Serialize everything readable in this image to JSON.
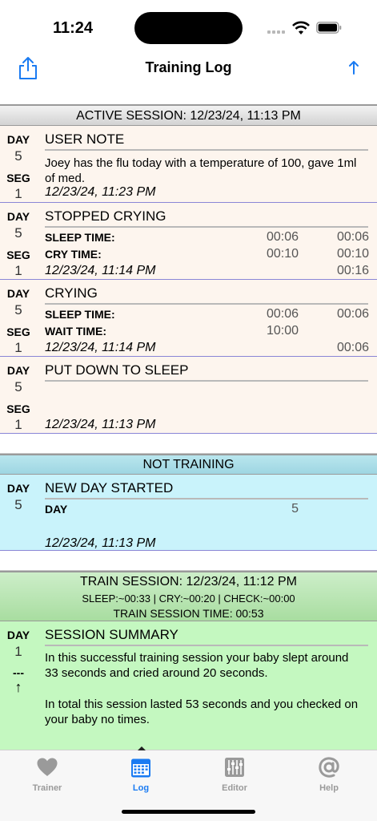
{
  "status": {
    "time": "11:24"
  },
  "nav": {
    "title": "Training Log"
  },
  "sessions": {
    "active": "ACTIVE SESSION: 12/23/24, 11:13 PM",
    "not_training": "NOT TRAINING",
    "train": {
      "title": "TRAIN SESSION: 12/23/24, 11:12 PM",
      "stats": "SLEEP:~00:33 | CRY:~00:20 | CHECK:~00:00",
      "time": "TRAIN SESSION TIME: 00:53"
    }
  },
  "labels": {
    "day": "DAY",
    "seg": "SEG",
    "dashes": "---",
    "up": "↑"
  },
  "rows": [
    {
      "day": "5",
      "seg": "1",
      "title": "USER NOTE",
      "note": "Joey has the flu today with a temperature of 100, gave 1ml of med.",
      "stamp": "12/23/24, 11:23 PM"
    },
    {
      "day": "5",
      "seg": "1",
      "title": "STOPPED CRYING",
      "f1": "SLEEP TIME:",
      "f1a": "00:06",
      "f1b": "00:06",
      "f2": "CRY TIME:",
      "f2a": "00:10",
      "f2b": "00:10",
      "total": "00:16",
      "stamp": "12/23/24, 11:14 PM"
    },
    {
      "day": "5",
      "seg": "1",
      "title": "CRYING",
      "f1": "SLEEP TIME:",
      "f1a": "00:06",
      "f1b": "00:06",
      "f2": "WAIT TIME:",
      "f2a": "10:00",
      "total": "00:06",
      "stamp": "12/23/24, 11:14 PM"
    },
    {
      "day": "5",
      "seg": "1",
      "title": "PUT DOWN TO SLEEP",
      "stamp": "12/23/24, 11:13 PM"
    },
    {
      "day": "5",
      "title": "NEW DAY STARTED",
      "f1": "DAY",
      "f1a": "5",
      "stamp": "12/23/24, 11:13 PM"
    },
    {
      "day": "1",
      "title": "SESSION SUMMARY",
      "p1": "In this successful training session your baby slept around 33 seconds and cried around 20 seconds.",
      "p2": "In total this session lasted 53 seconds and you checked on your baby no times."
    }
  ],
  "tabs": [
    {
      "label": "Trainer",
      "icon": "heart-icon"
    },
    {
      "label": "Log",
      "icon": "calendar-icon"
    },
    {
      "label": "Editor",
      "icon": "sliders-icon"
    },
    {
      "label": "Help",
      "icon": "at-icon"
    }
  ],
  "colors": {
    "accent": "#1a7bf2",
    "active_bg": "#fdf5ee",
    "not_training_bg": "#c9f3fb",
    "train_bg": "#c4f8c0"
  }
}
